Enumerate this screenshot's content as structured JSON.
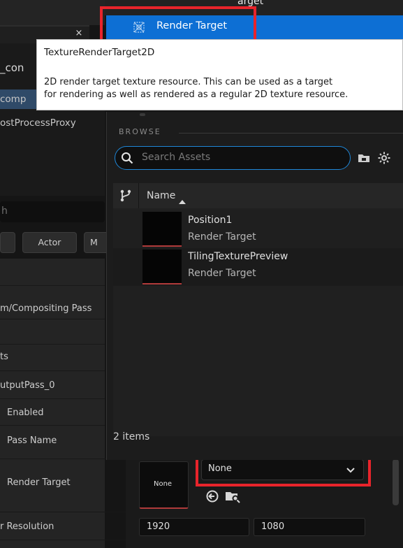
{
  "details": {
    "tab_close": "×",
    "row_con": "_con",
    "row_comp": "comp",
    "row_postprocess": "ostProcessProxy",
    "search_placeholder": "h",
    "chip_actor": "Actor",
    "chip_m": "M",
    "prop_compositing": "m/Compositing Pass",
    "prop_ts": "ts",
    "prop_output": "utputPass_0",
    "prop_enabled": "Enabled",
    "prop_passname": "Pass Name",
    "prop_render_target": "Render Target",
    "prop_resolution": "r Resolution"
  },
  "dropdown": {
    "above_item": "arget",
    "selected_item": "Render Target"
  },
  "tooltip": {
    "title": "TextureRenderTarget2D",
    "line1": "2D render target texture resource. This can be used as a target",
    "line2": "for rendering as well as rendered as a regular 2D texture resource."
  },
  "picker": {
    "browse_label": "BROWSE",
    "search_placeholder": "Search Assets",
    "column_name": "Name",
    "assets": [
      {
        "name": "Position1",
        "type": "Render Target"
      },
      {
        "name": "TilingTexturePreview",
        "type": "Render Target"
      }
    ],
    "items_count": "2 items"
  },
  "render_target": {
    "thumb_label": "None",
    "combo_value": "None"
  },
  "resolution": {
    "x": "1920",
    "y": "1080"
  },
  "colors": {
    "accent_blue": "#0d6fd4",
    "search_border": "#1f87d8",
    "highlight_red": "#e8242b"
  }
}
